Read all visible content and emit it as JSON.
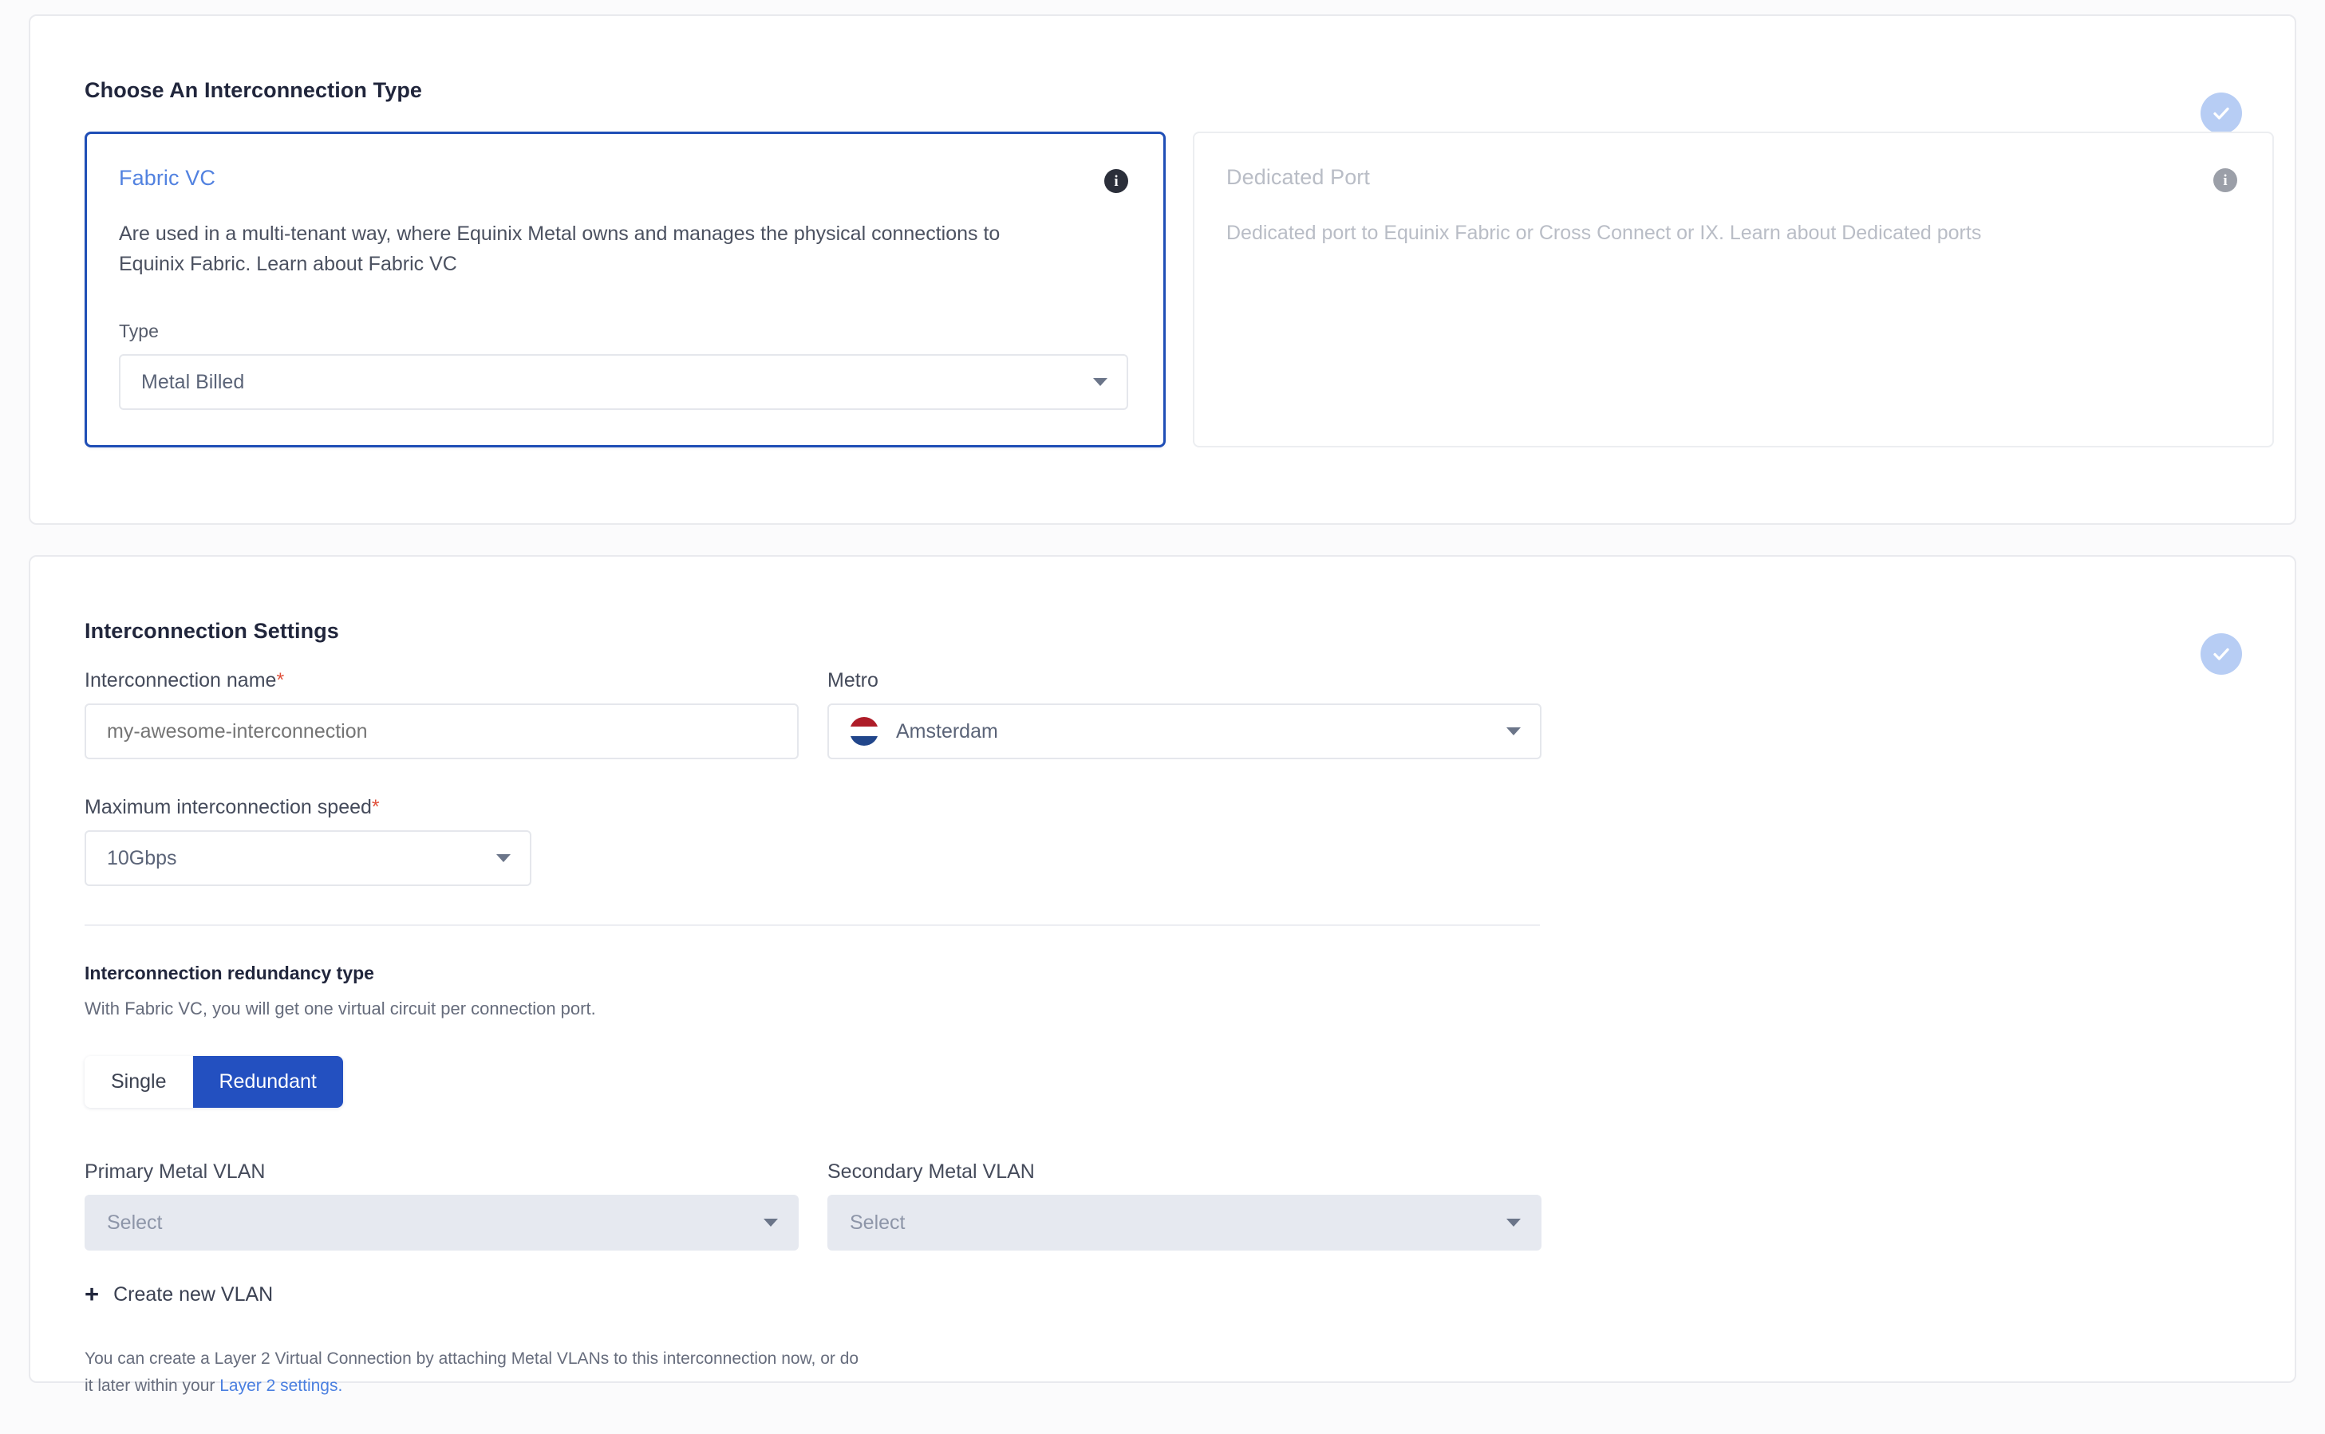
{
  "interconnection_type": {
    "title": "Choose An Interconnection Type",
    "status_icon": "check-circle-icon",
    "options": [
      {
        "name": "Fabric VC",
        "selected": true,
        "info_icon": "info-icon",
        "description": "Are used in a multi-tenant way, where Equinix Metal owns and manages the physical connections to Equinix Fabric. Learn about Fabric VC",
        "field_label": "Type",
        "field_value": "Metal Billed",
        "field_icon": "chevron-down-icon"
      },
      {
        "name": "Dedicated Port",
        "selected": false,
        "info_icon": "info-icon",
        "description": "Dedicated port to Equinix Fabric or Cross Connect or IX. Learn about Dedicated ports"
      }
    ]
  },
  "settings": {
    "title": "Interconnection Settings",
    "status_icon": "check-circle-icon",
    "name_field": {
      "label": "Interconnection name",
      "required_mark": "*",
      "placeholder": "my-awesome-interconnection",
      "value": ""
    },
    "metro_field": {
      "label": "Metro",
      "value": "Amsterdam",
      "flag_icon": "netherlands-flag-icon",
      "flag_colors": [
        "#ae1c28",
        "#ffffff",
        "#21468b"
      ],
      "caret_icon": "chevron-down-icon"
    },
    "speed_field": {
      "label": "Maximum interconnection speed",
      "required_mark": "*",
      "value": "10Gbps",
      "caret_icon": "chevron-down-icon"
    },
    "redundancy": {
      "title": "Interconnection redundancy type",
      "subtitle": "With Fabric VC, you will get one virtual circuit per connection port.",
      "options": [
        "Single",
        "Redundant"
      ],
      "selected": "Redundant"
    },
    "primary_vlan": {
      "label": "Primary Metal VLAN",
      "value": "Select",
      "caret_icon": "chevron-down-icon"
    },
    "secondary_vlan": {
      "label": "Secondary Metal VLAN",
      "value": "Select",
      "caret_icon": "chevron-down-icon"
    },
    "create_vlan": {
      "icon": "plus-icon",
      "label": "Create new VLAN"
    },
    "footnote": {
      "line1": "You can create a Layer 2 Virtual Connection by attaching Metal VLANs to this interconnection now, or do",
      "line2_prefix": "it later within your ",
      "link_text": "Layer 2 settings."
    }
  },
  "colors": {
    "accent_blue": "#2350c0",
    "selected_border": "#1f4eb6",
    "link_blue": "#4a7fe0",
    "required_red": "#e0513c",
    "check_badge": "#b7cdf4"
  }
}
